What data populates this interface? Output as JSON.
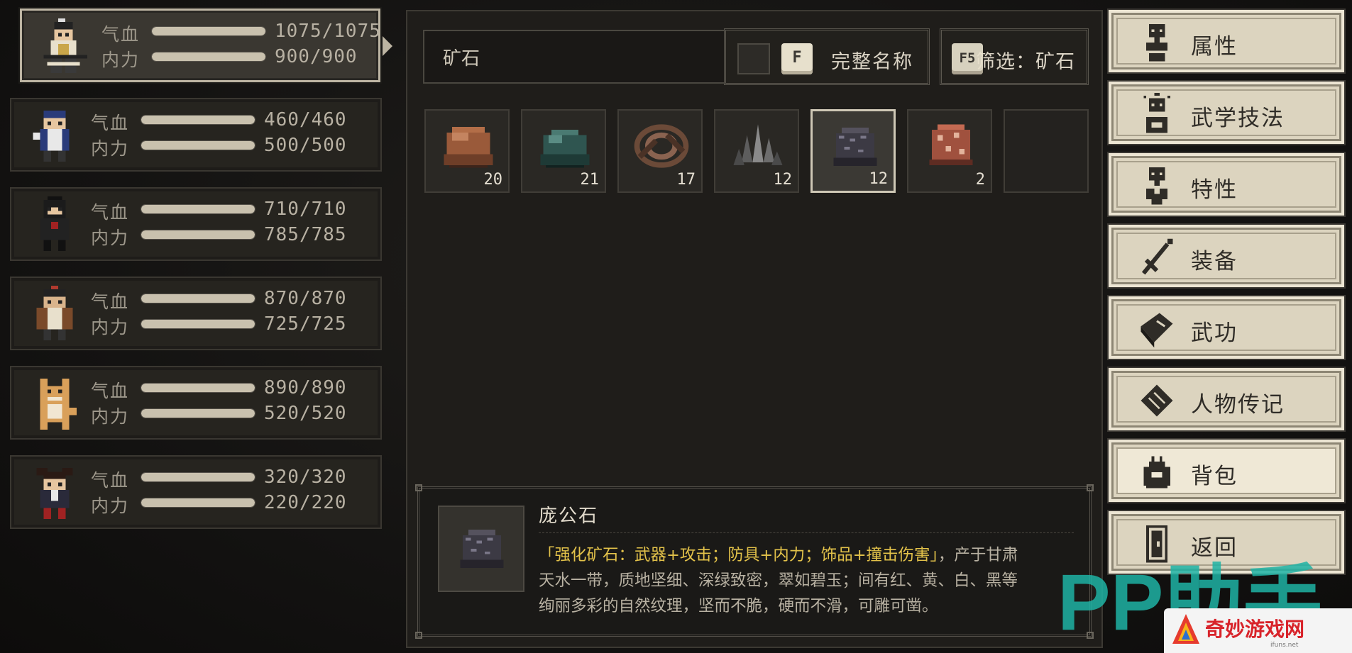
{
  "party": [
    {
      "hp_label": "气血",
      "mp_label": "内力",
      "hp": "1075/1075",
      "mp": "900/900",
      "hp_fill": 1.0,
      "mp_fill": 1.0,
      "selected": true
    },
    {
      "hp_label": "气血",
      "mp_label": "内力",
      "hp": "460/460",
      "mp": "500/500",
      "hp_fill": 1.0,
      "mp_fill": 1.0
    },
    {
      "hp_label": "气血",
      "mp_label": "内力",
      "hp": "710/710",
      "mp": "785/785",
      "hp_fill": 1.0,
      "mp_fill": 1.0
    },
    {
      "hp_label": "气血",
      "mp_label": "内力",
      "hp": "870/870",
      "mp": "725/725",
      "hp_fill": 1.0,
      "mp_fill": 1.0
    },
    {
      "hp_label": "气血",
      "mp_label": "内力",
      "hp": "890/890",
      "mp": "520/520",
      "hp_fill": 1.0,
      "mp_fill": 1.0
    },
    {
      "hp_label": "气血",
      "mp_label": "内力",
      "hp": "320/320",
      "mp": "220/220",
      "hp_fill": 1.0,
      "mp_fill": 1.0
    }
  ],
  "inventory": {
    "search_value": "矿石",
    "fullname_key": "F",
    "fullname_label": "完整名称",
    "filter_key": "F5",
    "filter_label": "筛选：矿石",
    "items": [
      {
        "icon": "copper-ore-icon",
        "count": "20",
        "color": "#9a5a3a"
      },
      {
        "icon": "jade-ore-icon",
        "count": "21",
        "color": "#2f5550"
      },
      {
        "icon": "coiled-ore-icon",
        "count": "17",
        "color": "#6b4a38"
      },
      {
        "icon": "crystal-ore-icon",
        "count": "12",
        "color": "#6d6d6d"
      },
      {
        "icon": "panggong-stone-icon",
        "count": "12",
        "color": "#3c3a44",
        "selected": true
      },
      {
        "icon": "red-spotted-ore-icon",
        "count": "2",
        "color": "#a0513e"
      },
      {
        "icon": "",
        "count": ""
      }
    ]
  },
  "detail": {
    "name": "庞公石",
    "effect": "「强化矿石：武器+攻击；防具+内力；饰品+撞击伤害」",
    "desc1": "，产于甘肃",
    "desc2": "天水一带，质地坚细、深绿致密，翠如碧玉；间有红、黄、白、黑等",
    "desc3": "绚丽多彩的自然纹理，坚而不脆，硬而不滑，可雕可凿。"
  },
  "menu": [
    {
      "label": "属性",
      "icon": "attributes-icon"
    },
    {
      "label": "武学技法",
      "icon": "martial-skills-icon"
    },
    {
      "label": "特性",
      "icon": "traits-icon"
    },
    {
      "label": "装备",
      "icon": "sword-icon"
    },
    {
      "label": "武功",
      "icon": "book-icon"
    },
    {
      "label": "人物传记",
      "icon": "scroll-icon"
    },
    {
      "label": "背包",
      "icon": "bag-icon",
      "active": true
    },
    {
      "label": "返回",
      "icon": "door-icon"
    }
  ],
  "watermark": {
    "main": "PP助手",
    "site": "奇妙游戏网",
    "domain": "ifuns.net"
  },
  "colors": {
    "hp_bar": "#c9c1ae",
    "highlight": "#e3c24a",
    "menu_bg": "#dcd4bf",
    "watermark_teal": "#1fb3a4"
  }
}
